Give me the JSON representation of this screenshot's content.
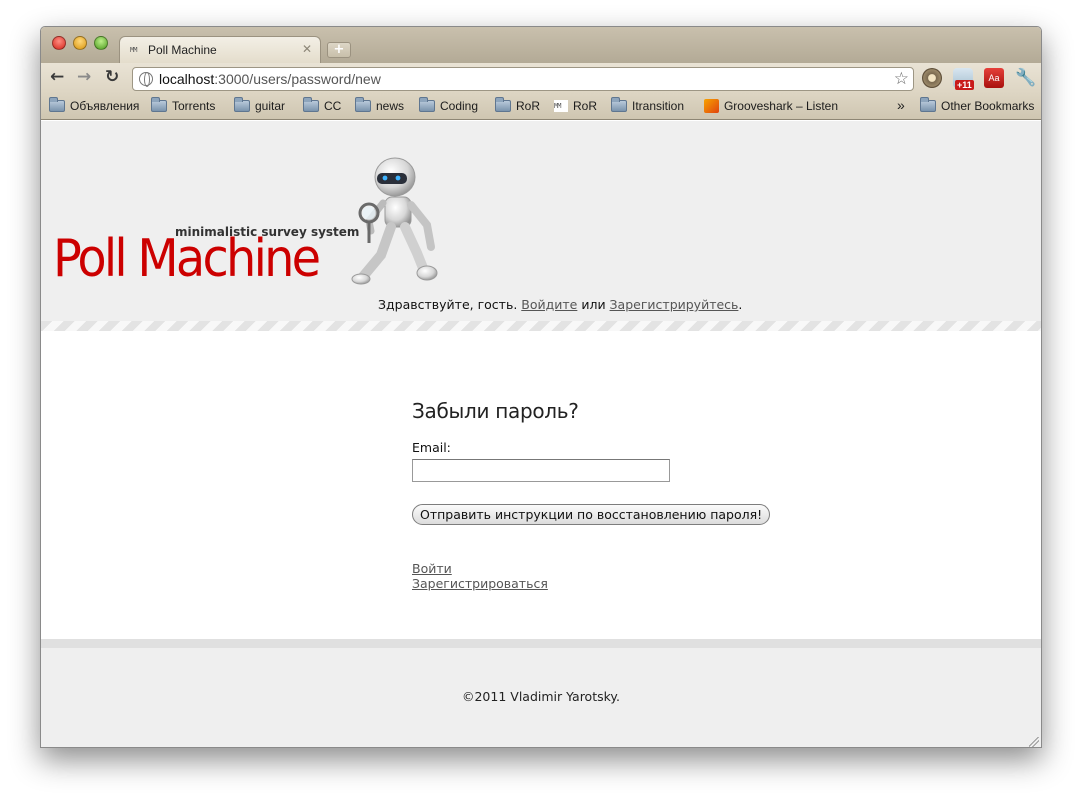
{
  "browser": {
    "tab_title": "Poll Machine",
    "tab_favicon": "MM",
    "url_host": "localhost",
    "url_path": ":3000/users/password/new",
    "bookmarks": [
      {
        "label": "Объявления",
        "icon": "folder-icon"
      },
      {
        "label": "Torrents",
        "icon": "folder-icon"
      },
      {
        "label": "guitar",
        "icon": "folder-icon"
      },
      {
        "label": "CC",
        "icon": "folder-icon"
      },
      {
        "label": "news",
        "icon": "folder-icon"
      },
      {
        "label": "Coding",
        "icon": "folder-icon"
      },
      {
        "label": "RoR",
        "icon": "folder-icon"
      },
      {
        "label": "RoR",
        "icon": "mm-favicon"
      },
      {
        "label": "Itransition",
        "icon": "folder-icon"
      },
      {
        "label": "Grooveshark – Listen",
        "icon": "grooveshark-icon"
      },
      {
        "label": "Other Bookmarks",
        "icon": "folder-icon"
      }
    ],
    "overflow": "»",
    "extension_badge": "+11",
    "extension_aa": "Aa"
  },
  "header": {
    "logo": "Poll Machine",
    "tagline": "minimalistic survey system",
    "greeting_prefix": "Здравствуйте, гость. ",
    "login_link": "Войдите",
    "greeting_middle": " или ",
    "register_link": "Зарегистрируйтесь",
    "greeting_suffix": "."
  },
  "form": {
    "title": "Забыли пароль?",
    "email_label": "Email:",
    "email_value": "",
    "submit_label": "Отправить инструкции по восстановлению пароля!"
  },
  "links": {
    "login": "Войти",
    "register": "Зарегистрироваться"
  },
  "footer": {
    "copyright": "©2011 Vladimir Yarotsky."
  },
  "colors": {
    "logo": "#cc0000",
    "header_bg": "#efefef"
  }
}
